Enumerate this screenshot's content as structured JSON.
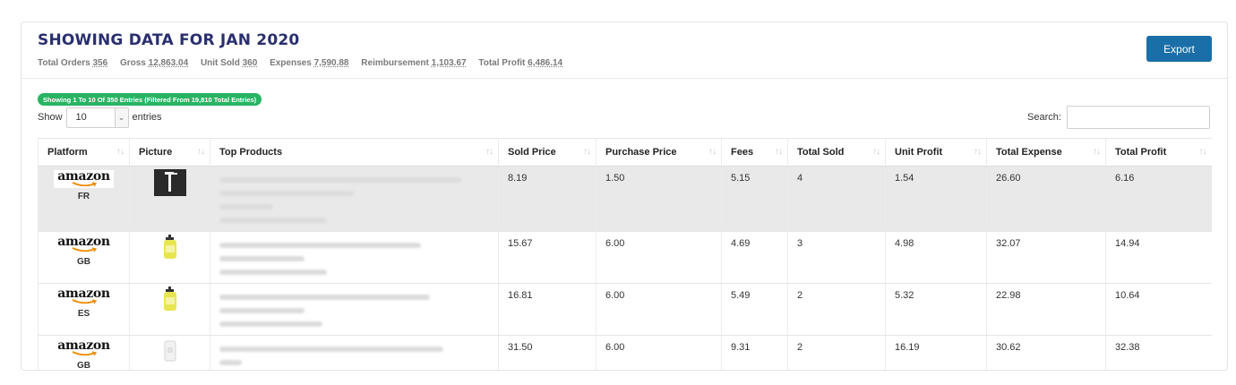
{
  "header": {
    "title": "SHOWING DATA FOR JAN 2020",
    "stats": [
      {
        "label": "Total Orders",
        "value": "356"
      },
      {
        "label": "Gross",
        "value": "12,863.04"
      },
      {
        "label": "Unit Sold",
        "value": "360"
      },
      {
        "label": "Expenses",
        "value": "7,590.88"
      },
      {
        "label": "Reimbursement",
        "value": "1,103.67"
      },
      {
        "label": "Total Profit",
        "value": "6,486.14"
      }
    ],
    "export_label": "Export"
  },
  "table_info": {
    "entries_badge": "Showing 1 To 10 Of 350 Entries (Filtered From 19,810 Total Entries)",
    "show_label": "Show",
    "page_length": "10",
    "entries_label": "entries",
    "search_label": "Search:",
    "search_value": ""
  },
  "columns": [
    "Platform",
    "Picture",
    "Top Products",
    "Sold Price",
    "Purchase Price",
    "Fees",
    "Total Sold",
    "Unit Profit",
    "Total Expense",
    "Total Profit"
  ],
  "rows": [
    {
      "platform": "amazon",
      "country": "FR",
      "sold_price": "8.19",
      "purchase_price": "1.50",
      "fees": "5.15",
      "total_sold": "4",
      "unit_profit": "1.54",
      "total_expense": "26.60",
      "total_profit": "6.16"
    },
    {
      "platform": "amazon",
      "country": "GB",
      "sold_price": "15.67",
      "purchase_price": "6.00",
      "fees": "4.69",
      "total_sold": "3",
      "unit_profit": "4.98",
      "total_expense": "32.07",
      "total_profit": "14.94"
    },
    {
      "platform": "amazon",
      "country": "ES",
      "sold_price": "16.81",
      "purchase_price": "6.00",
      "fees": "5.49",
      "total_sold": "2",
      "unit_profit": "5.32",
      "total_expense": "22.98",
      "total_profit": "10.64"
    },
    {
      "platform": "amazon",
      "country": "GB",
      "sold_price": "31.50",
      "purchase_price": "6.00",
      "fees": "9.31",
      "total_sold": "2",
      "unit_profit": "16.19",
      "total_expense": "30.62",
      "total_profit": "32.38"
    }
  ],
  "colors": {
    "title": "#2a2f6e",
    "export_button": "#1a6fa8",
    "badge": "#28b463",
    "amazon_smile": "#f08c00",
    "selected_row": "#e9e9e9"
  }
}
